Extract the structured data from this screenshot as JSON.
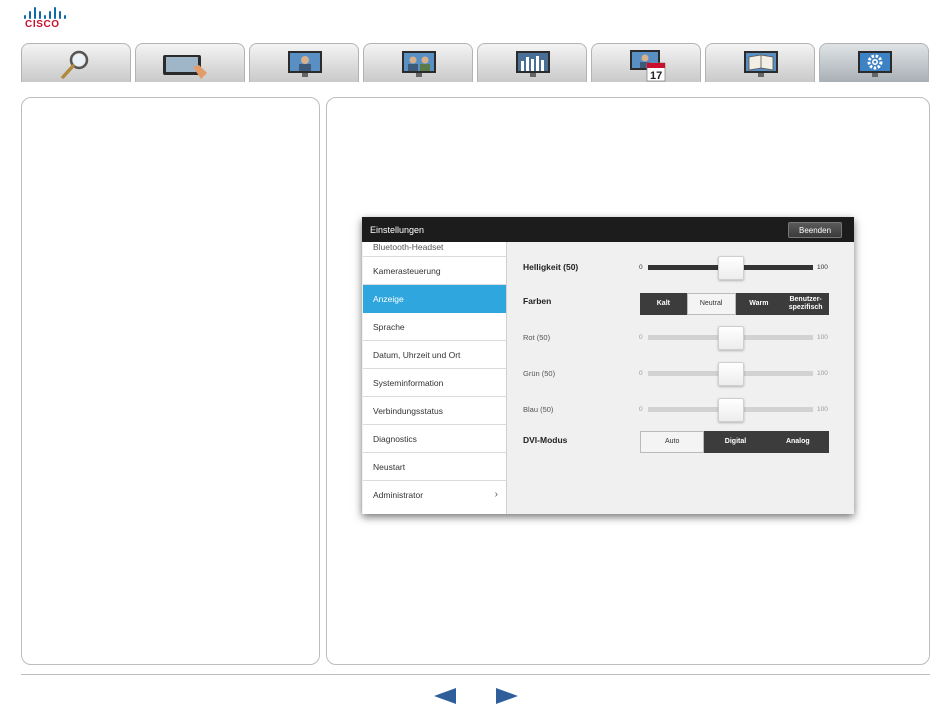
{
  "brand": {
    "name": "CISCO",
    "color": "#c8102e",
    "bar_color": "#0e6aa8"
  },
  "tabs": [
    {
      "icon": "magnifier-icon"
    },
    {
      "icon": "touch-panel-icon"
    },
    {
      "icon": "video-call-icon"
    },
    {
      "icon": "multisite-call-icon"
    },
    {
      "icon": "presentation-chart-icon"
    },
    {
      "icon": "calendar-icon",
      "badge": "17"
    },
    {
      "icon": "phonebook-icon"
    },
    {
      "icon": "settings-gear-icon",
      "active": true
    }
  ],
  "settings": {
    "title": "Einstellungen",
    "close_label": "Beenden",
    "menu": [
      {
        "label": "Bluetooth-Headset"
      },
      {
        "label": "Kamerasteuerung"
      },
      {
        "label": "Anzeige",
        "active": true
      },
      {
        "label": "Sprache"
      },
      {
        "label": "Datum, Uhrzeit und Ort"
      },
      {
        "label": "Systeminformation"
      },
      {
        "label": "Verbindungsstatus"
      },
      {
        "label": "Diagnostics"
      },
      {
        "label": "Neustart"
      },
      {
        "label": "Administrator",
        "chevron": "›"
      }
    ],
    "brightness": {
      "label": "Helligkeit (50)",
      "min": "0",
      "max": "100",
      "value": 50
    },
    "colors": {
      "label": "Farben",
      "options": [
        "Kalt",
        "Neutral",
        "Warm",
        "Benutzer-\nspezifisch"
      ],
      "selected": "Neutral"
    },
    "red": {
      "label": "Rot (50)",
      "min": "0",
      "max": "100",
      "value": 50
    },
    "green": {
      "label": "Grün (50)",
      "min": "0",
      "max": "100",
      "value": 50
    },
    "blue": {
      "label": "Blau (50)",
      "min": "0",
      "max": "100",
      "value": 50
    },
    "dvi": {
      "label": "DVI-Modus",
      "options": [
        "Auto",
        "Digital",
        "Analog"
      ],
      "selected": "Auto"
    }
  },
  "pagination": {
    "prev_icon": "arrow-left-icon",
    "next_icon": "arrow-right-icon",
    "color": "#2f5f9a"
  }
}
